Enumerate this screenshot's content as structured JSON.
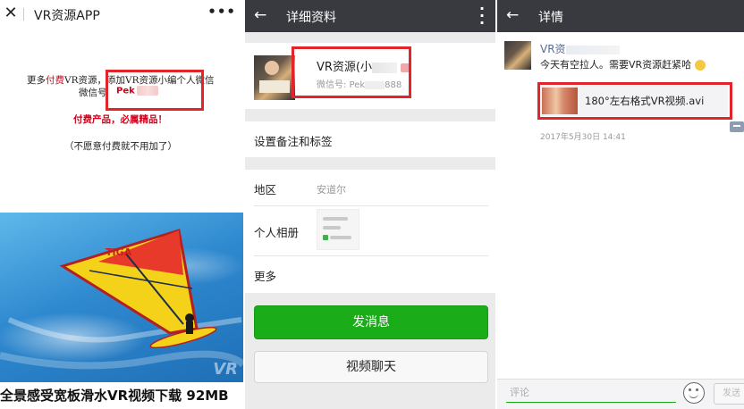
{
  "panel1": {
    "title": "VR资源APP",
    "close_icon": "close-icon",
    "more_icon": "more-dots-icon",
    "line1_pre": "更多",
    "line1_red": "付费",
    "line1_post": "VR资源，添加VR资源小编个人微信",
    "line2": "微信号",
    "wechat_prefix": "Pek",
    "paid_note": "付费产品，必属精品！",
    "skip_note": "（不愿意付费就不用加了）",
    "image_watermark": "VR",
    "caption": "全景感受宽板滑水VR视频下载 92MB"
  },
  "panel2": {
    "title": "详细资料",
    "profile_name": "VR资源(小",
    "wechat_label": "微信号: Pek",
    "wechat_suffix": "888",
    "set_remark": "设置备注和标签",
    "region_label": "地区",
    "region_value": "安道尔",
    "album_label": "个人相册",
    "more_label": "更多",
    "send_message": "发消息",
    "video_chat": "视频聊天"
  },
  "panel3": {
    "title": "详情",
    "poster_name": "VR资",
    "post_text": "今天有空拉人。需要VR资源赶紧哈",
    "link_title": "180°左右格式VR视频.avi",
    "time": "2017年5月30日 14:41",
    "comment_placeholder": "评论",
    "send_label": "发送"
  },
  "colors": {
    "accent_red": "#e0252b",
    "wechat_green": "#1aad19",
    "nav_dark": "#393a3f",
    "link_blue": "#576b95"
  }
}
